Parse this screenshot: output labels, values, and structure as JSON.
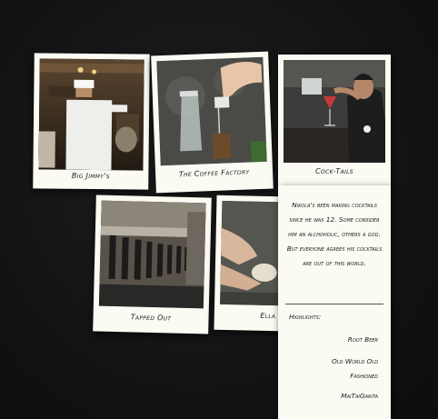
{
  "cards": [
    {
      "caption": "Big Jimmy's",
      "photo_icon": "chef-at-bar-photo"
    },
    {
      "caption": "The Coffee Factory",
      "photo_icon": "pouring-carafe-photo"
    },
    {
      "caption": "Cock-Tails",
      "photo_icon": "bartender-straining-cocktail-photo"
    },
    {
      "caption": "Tapped Out",
      "photo_icon": "beer-taps-photo"
    },
    {
      "caption": "Ella",
      "photo_icon": "hands-holding-coaster-photo"
    }
  ],
  "detail": {
    "story": "Nikola's been making cocktails since he was 12. Some consider him an alchoholic, others a god. But everyone agrees his cocktails are out of this world.",
    "highlights_label": "Highlights:",
    "highlights": [
      "Root Beer",
      "Old World Old Fashioned",
      "MaiTaiGarita"
    ]
  }
}
